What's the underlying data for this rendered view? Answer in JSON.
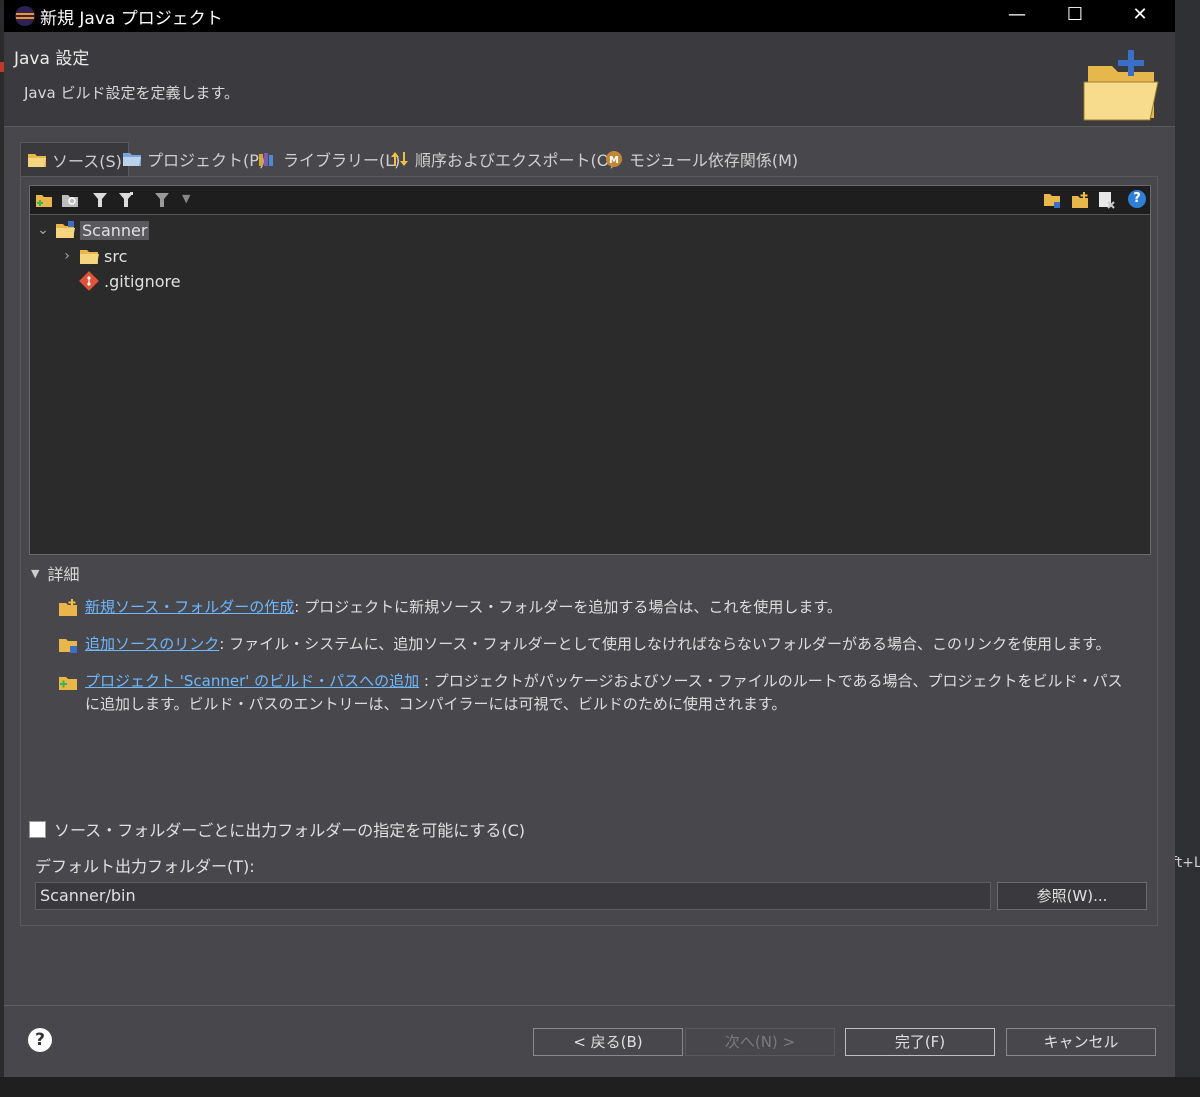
{
  "window": {
    "title": "新規 Java プロジェクト",
    "controls": [
      "—",
      "☐",
      "✕"
    ]
  },
  "header": {
    "title": "Java 設定",
    "description": "Java ビルド設定を定義します。"
  },
  "tabs": [
    {
      "label": "ソース(S)",
      "icon": "source-folder-icon",
      "active": true
    },
    {
      "label": "プロジェクト(P)",
      "icon": "project-icon",
      "active": false
    },
    {
      "label": "ライブラリー(L)",
      "icon": "library-icon",
      "active": false
    },
    {
      "label": "順序およびエクスポート(O)",
      "icon": "order-export-icon",
      "active": false
    },
    {
      "label": "モジュール依存関係(M)",
      "icon": "module-icon",
      "active": false
    }
  ],
  "tree": {
    "root": {
      "label": "Scanner",
      "expanded": true
    },
    "children": [
      {
        "label": "src",
        "expandable": true
      },
      {
        "label": ".gitignore",
        "expandable": false
      }
    ]
  },
  "details": {
    "label": "詳細",
    "items": [
      {
        "link": "新規ソース・フォルダーの作成",
        "text": ": プロジェクトに新規ソース・フォルダーを追加する場合は、これを使用します。"
      },
      {
        "link": "追加ソースのリンク",
        "text": ": ファイル・システムに、追加ソース・フォルダーとして使用しなければならないフォルダーがある場合、このリンクを使用します。"
      },
      {
        "link": "プロジェクト 'Scanner' のビルド・パスへの追加",
        "text": " : プロジェクトがパッケージおよびソース・ファイルのルートである場合、プロジェクトをビルド・パスに追加します。ビルド・パスのエントリーは、コンパイラーには可視で、ビルドのために使用されます。"
      }
    ]
  },
  "output": {
    "checkbox_label": "ソース・フォルダーごとに出力フォルダーの指定を可能にする(C)",
    "checked": false,
    "default_label": "デフォルト出力フォルダー(T):",
    "default_value": "Scanner/bin",
    "browse_label": "参照(W)..."
  },
  "footer": {
    "back": "< 戻る(B)",
    "next": "次へ(N) >",
    "finish": "完了(F)",
    "cancel": "キャンセル"
  },
  "background": {
    "right_text": "ft+L"
  }
}
